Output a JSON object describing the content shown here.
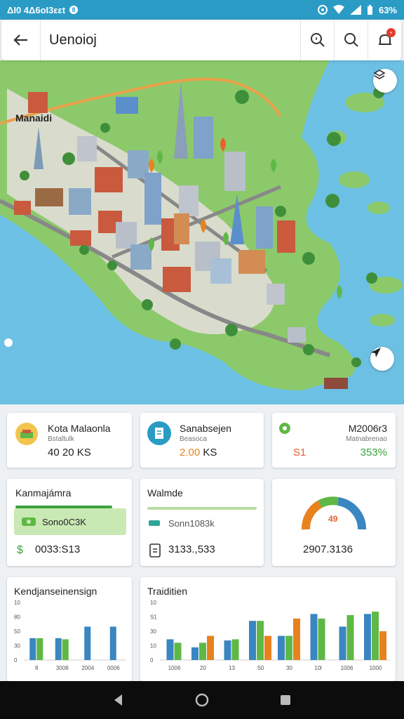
{
  "status_bar": {
    "left_text": "ΔI0 4Δ6οI3εεt",
    "battery": "63%"
  },
  "app_bar": {
    "title": "Uenoioj"
  },
  "map": {
    "region_label": "Manaidi"
  },
  "cards": {
    "stat1": {
      "title": "Kota Malaonla",
      "subtitle": "Bstaltulk",
      "value": "40 20 KS"
    },
    "stat2": {
      "title": "Sanabsejen",
      "subtitle": "Beasoca",
      "value_highlight": "2.00",
      "value_unit": "KS"
    },
    "stat3": {
      "title": "M2006r3",
      "subtitle": "Matnabrenao",
      "left_value": "S1",
      "right_value": "353%"
    },
    "mid1": {
      "title": "Kanmajámra",
      "pill_label": "Sono0C3K",
      "value": "0033:S13"
    },
    "mid2": {
      "title": "Walmde",
      "row_label": "Sonn1083k",
      "value": "3133.,533"
    },
    "mid3": {
      "gauge_label": "49",
      "value": "2907.3136"
    },
    "chart1": {
      "title": "Kendjanseinensign"
    },
    "chart2": {
      "title": "Traiditien"
    }
  },
  "colors": {
    "accent_blue": "#2a9bc4",
    "green": "#5fb845",
    "orange": "#e8821f",
    "bar_blue": "#3a86c0",
    "bar_teal": "#2fa59a"
  },
  "chart_data": [
    {
      "type": "bar",
      "title": "Kendjanseinensign",
      "y_ticks": [
        "10",
        "80",
        "50",
        "30",
        "0"
      ],
      "categories": [
        "8",
        "3008",
        "2004",
        "0006"
      ],
      "series": [
        {
          "values": [
            38,
            38,
            58,
            58
          ]
        },
        {
          "values": [
            38,
            36,
            0,
            0
          ]
        }
      ]
    },
    {
      "type": "bar",
      "title": "Traiditien",
      "y_ticks": [
        "10",
        "S1",
        "30",
        "10",
        "0"
      ],
      "categories": [
        "1006",
        "20",
        "13",
        "S0",
        "30",
        "10l",
        "1006",
        "1000"
      ],
      "series": [
        {
          "values": [
            36,
            22,
            34,
            68,
            42,
            80,
            58,
            80
          ]
        },
        {
          "values": [
            30,
            30,
            36,
            68,
            42,
            72,
            78,
            84
          ]
        },
        {
          "values": [
            0,
            42,
            0,
            42,
            72,
            0,
            0,
            50
          ]
        }
      ]
    }
  ]
}
